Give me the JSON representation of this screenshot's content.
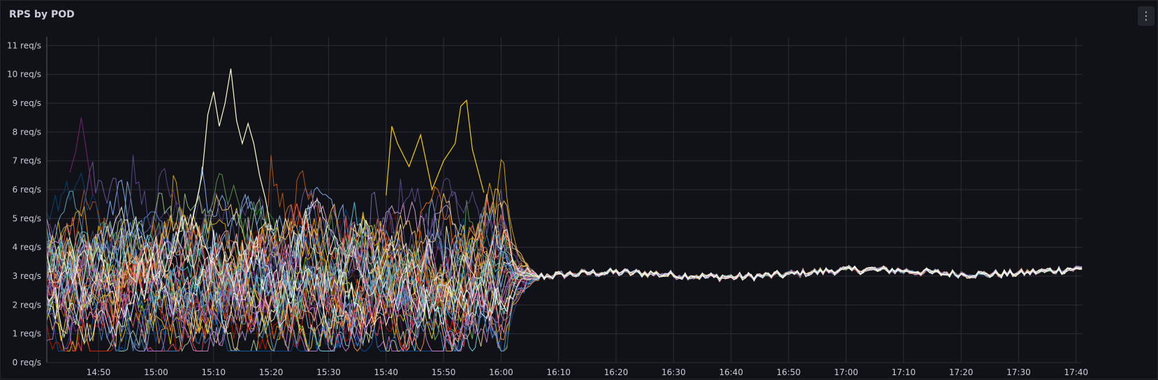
{
  "panel": {
    "title": "RPS by POD",
    "menu_icon": "vertical-ellipsis-icon"
  },
  "colors": {
    "background": "#111217",
    "grid": "#2c2f36",
    "text": "#ccccdc",
    "series_palette": [
      "#73bf69",
      "#f2cc0c",
      "#8ab8ff",
      "#ff780a",
      "#f2495c",
      "#5794f2",
      "#b877d9",
      "#705da0",
      "#37872d",
      "#fade2a",
      "#447ebc",
      "#c15c17",
      "#890f02",
      "#0a437c",
      "#6d1f62",
      "#584477",
      "#b7dbab",
      "#f4d598",
      "#70dbed",
      "#f9ba8f",
      "#f29191",
      "#82b5d8",
      "#e5a8e2",
      "#aea2e0",
      "#629e51",
      "#e5ac0e",
      "#64b0c8",
      "#e0752d",
      "#bf1b00",
      "#0a50a1",
      "#962d82",
      "#614d93",
      "#9ac48a",
      "#f2c96d",
      "#65c5db",
      "#f9934e",
      "#ea6460",
      "#5195ce",
      "#d683ce",
      "#806eb7",
      "#ffffff",
      "#f5f5dc",
      "#fffacd",
      "#e0ffff"
    ]
  },
  "chart_data": {
    "type": "line",
    "title": "RPS by POD",
    "xlabel": "",
    "ylabel": "",
    "x_ticks": [
      "14:50",
      "15:00",
      "15:10",
      "15:20",
      "15:30",
      "15:40",
      "15:50",
      "16:00",
      "16:10",
      "16:20",
      "16:30",
      "16:40",
      "16:50",
      "17:00",
      "17:10",
      "17:20",
      "17:30",
      "17:40"
    ],
    "y_ticks": [
      "0 req/s",
      "1 req/s",
      "2 req/s",
      "3 req/s",
      "4 req/s",
      "5 req/s",
      "6 req/s",
      "7 req/s",
      "8 req/s",
      "9 req/s",
      "10 req/s",
      "11 req/s"
    ],
    "y_unit": "req/s",
    "xlim": [
      "14:41",
      "17:41"
    ],
    "ylim": [
      0,
      11.3
    ],
    "grid": true,
    "legend": "none",
    "series_count": 44,
    "profile": {
      "phase1_range": [
        "14:41",
        "16:07"
      ],
      "phase1_typical_range": [
        0.5,
        6.5
      ],
      "phase1_mean": 2.9,
      "phase2_range": [
        "16:07",
        "17:41"
      ],
      "phase2_mean": 3.0,
      "phase2_band": [
        2.6,
        3.4
      ]
    },
    "highlighted_series": [
      {
        "color": "#fffacd",
        "points": [
          [
            "15:06",
            4.6
          ],
          [
            "15:08",
            6.5
          ],
          [
            "15:09",
            8.6
          ],
          [
            "15:10",
            9.4
          ],
          [
            "15:11",
            8.2
          ],
          [
            "15:12",
            9.0
          ],
          [
            "15:13",
            10.2
          ],
          [
            "15:14",
            8.4
          ],
          [
            "15:15",
            7.6
          ],
          [
            "15:16",
            8.3
          ],
          [
            "15:17",
            7.6
          ],
          [
            "15:18",
            6.5
          ],
          [
            "15:19",
            5.7
          ],
          [
            "15:20",
            4.6
          ]
        ]
      },
      {
        "color": "#f2cc0c",
        "points": [
          [
            "15:40",
            5.8
          ],
          [
            "15:41",
            8.2
          ],
          [
            "15:42",
            7.6
          ],
          [
            "15:44",
            6.8
          ],
          [
            "15:46",
            7.9
          ],
          [
            "15:48",
            6.0
          ],
          [
            "15:50",
            7.0
          ],
          [
            "15:52",
            7.6
          ],
          [
            "15:53",
            8.9
          ],
          [
            "15:54",
            9.1
          ],
          [
            "15:55",
            7.4
          ],
          [
            "15:57",
            5.9
          ]
        ]
      },
      {
        "color": "#6d1f62",
        "points": [
          [
            "14:45",
            6.6
          ],
          [
            "14:46",
            7.3
          ],
          [
            "14:47",
            8.5
          ],
          [
            "14:48",
            7.2
          ],
          [
            "14:49",
            5.8
          ]
        ]
      }
    ]
  }
}
